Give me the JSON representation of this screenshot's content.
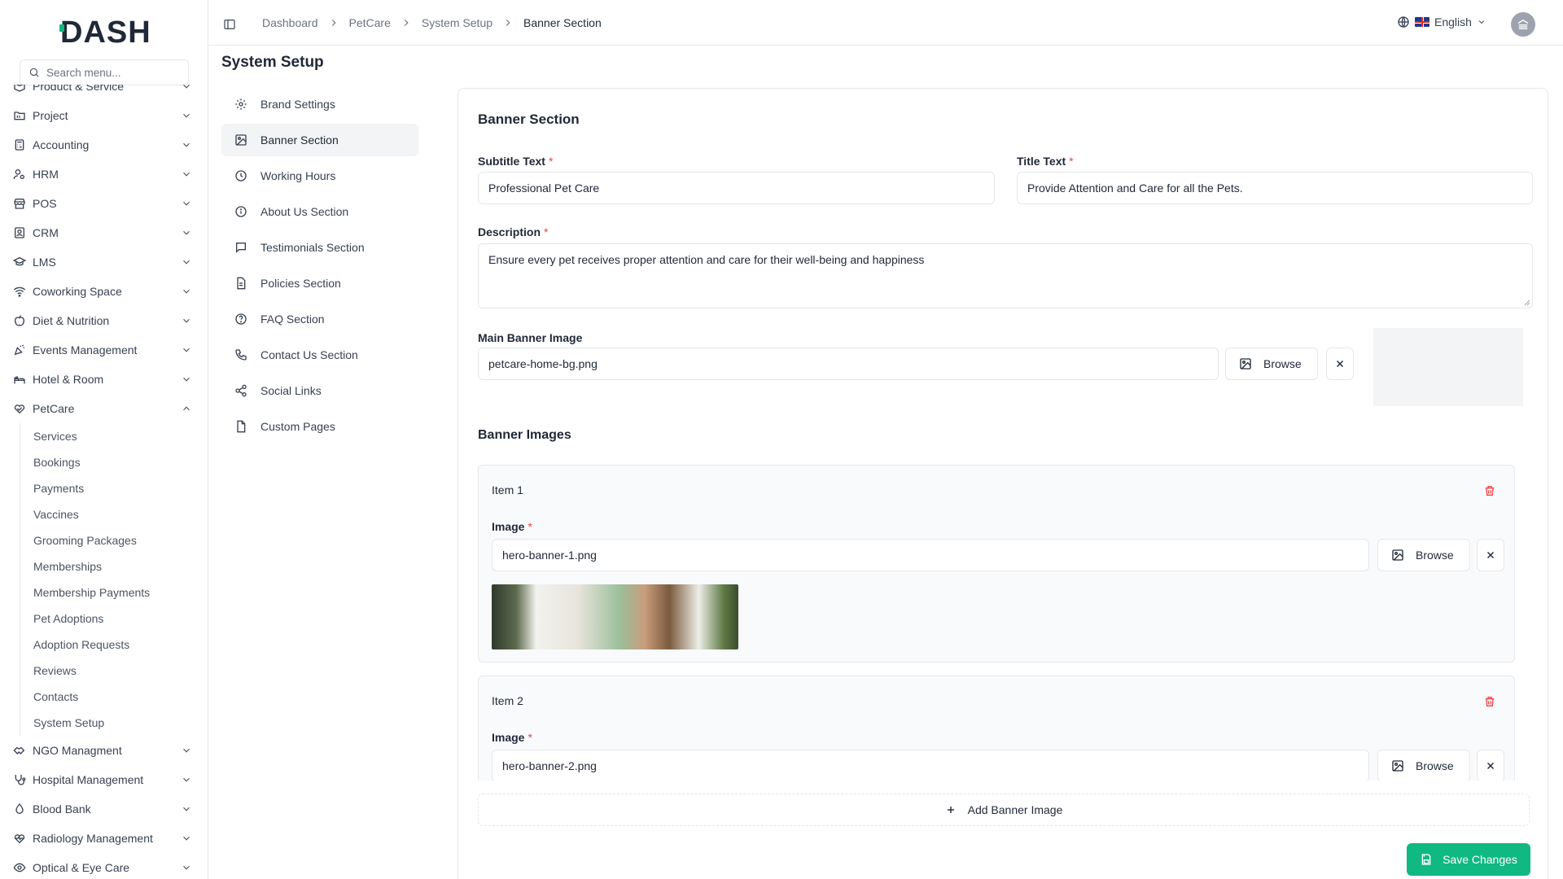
{
  "app": {
    "logo_text": "DASH"
  },
  "search": {
    "placeholder": "Search menu..."
  },
  "sidebar": {
    "items": [
      {
        "label": "Product & Service",
        "icon": "box-icon",
        "expanded": false
      },
      {
        "label": "Project",
        "icon": "folder-icon",
        "expanded": false
      },
      {
        "label": "Accounting",
        "icon": "calculator-icon",
        "expanded": false
      },
      {
        "label": "HRM",
        "icon": "users-icon",
        "expanded": false
      },
      {
        "label": "POS",
        "icon": "store-icon",
        "expanded": false
      },
      {
        "label": "CRM",
        "icon": "contact-icon",
        "expanded": false
      },
      {
        "label": "LMS",
        "icon": "graduation-icon",
        "expanded": false
      },
      {
        "label": "Coworking Space",
        "icon": "wifi-icon",
        "expanded": false
      },
      {
        "label": "Diet & Nutrition",
        "icon": "apple-icon",
        "expanded": false
      },
      {
        "label": "Events Management",
        "icon": "party-icon",
        "expanded": false
      },
      {
        "label": "Hotel & Room",
        "icon": "hotel-icon",
        "expanded": false
      },
      {
        "label": "PetCare",
        "icon": "heart-hand-icon",
        "expanded": true
      }
    ],
    "petcare_sub": [
      "Services",
      "Bookings",
      "Payments",
      "Vaccines",
      "Grooming Packages",
      "Memberships",
      "Membership Payments",
      "Pet Adoptions",
      "Adoption Requests",
      "Reviews",
      "Contacts",
      "System Setup"
    ],
    "items_after": [
      {
        "label": "NGO Managment",
        "icon": "handshake-icon",
        "expanded": false
      },
      {
        "label": "Hospital Management",
        "icon": "stethoscope-icon",
        "expanded": false
      },
      {
        "label": "Blood Bank",
        "icon": "droplet-icon",
        "expanded": false
      },
      {
        "label": "Radiology Management",
        "icon": "heart-pulse-icon",
        "expanded": false
      },
      {
        "label": "Optical & Eye Care",
        "icon": "eye-icon",
        "expanded": false
      }
    ]
  },
  "header": {
    "breadcrumb": [
      "Dashboard",
      "PetCare",
      "System Setup",
      "Banner Section"
    ],
    "language": "English"
  },
  "page": {
    "title": "System Setup"
  },
  "settings_nav": [
    {
      "label": "Brand Settings",
      "icon": "gear-icon"
    },
    {
      "label": "Banner Section",
      "icon": "image-icon",
      "active": true
    },
    {
      "label": "Working Hours",
      "icon": "clock-icon"
    },
    {
      "label": "About Us Section",
      "icon": "info-icon"
    },
    {
      "label": "Testimonials Section",
      "icon": "message-icon"
    },
    {
      "label": "Policies Section",
      "icon": "file-text-icon"
    },
    {
      "label": "FAQ Section",
      "icon": "help-circle-icon"
    },
    {
      "label": "Contact Us Section",
      "icon": "phone-icon"
    },
    {
      "label": "Social Links",
      "icon": "share-icon"
    },
    {
      "label": "Custom Pages",
      "icon": "file-icon"
    }
  ],
  "banner_form": {
    "title": "Banner Section",
    "subtitle_label": "Subtitle Text",
    "subtitle_value": "Professional Pet Care",
    "title_label": "Title Text",
    "title_value": "Provide Attention and Care for all the Pets.",
    "description_label": "Description",
    "description_value": "Ensure every pet receives proper attention and care for their well-being and happiness",
    "main_image_label": "Main Banner Image",
    "main_image_value": "petcare-home-bg.png",
    "browse_label": "Browse",
    "banner_images_title": "Banner Images",
    "items": [
      {
        "title": "Item 1",
        "image_label": "Image",
        "image_value": "hero-banner-1.png"
      },
      {
        "title": "Item 2",
        "image_label": "Image",
        "image_value": "hero-banner-2.png"
      }
    ],
    "add_label": "Add Banner Image",
    "save_label": "Save Changes"
  },
  "colors": {
    "accent": "#10b981",
    "required": "#ef4444",
    "danger": "#ef4444"
  }
}
